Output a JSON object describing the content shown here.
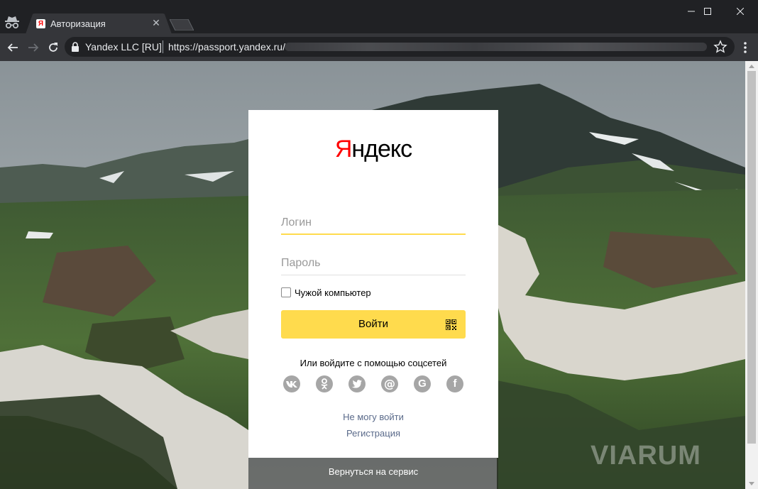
{
  "browser": {
    "tab_title": "Авторизация",
    "tab_favicon": "Я",
    "org": "Yandex LLC [RU]",
    "url": "https://passport.yandex.ru/"
  },
  "auth": {
    "logo_first": "Я",
    "logo_rest": "ндекс",
    "login_placeholder": "Логин",
    "password_placeholder": "Пароль",
    "foreign_computer": "Чужой компьютер",
    "login_button": "Войти",
    "social_title": "Или войдите с помощью соцсетей",
    "social": [
      {
        "name": "vk-icon",
        "glyph": "vk"
      },
      {
        "name": "odnoklassniki-icon",
        "glyph": "ok"
      },
      {
        "name": "twitter-icon",
        "glyph": "tw"
      },
      {
        "name": "mailru-icon",
        "glyph": "@"
      },
      {
        "name": "google-icon",
        "glyph": "G"
      },
      {
        "name": "facebook-icon",
        "glyph": "f"
      }
    ],
    "cant_login": "Не могу войти",
    "register": "Регистрация",
    "back_to_service": "Вернуться на сервис"
  },
  "watermark": "VIARUM",
  "colors": {
    "accent_yellow": "#ffdb4d",
    "logo_red": "#ff0000",
    "link": "#5a6a8a",
    "chrome_dark": "#202124",
    "chrome_toolbar": "#35363a"
  }
}
